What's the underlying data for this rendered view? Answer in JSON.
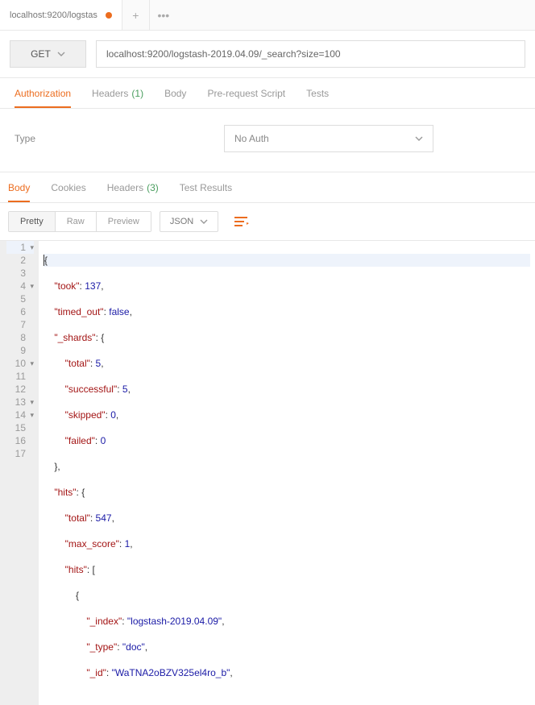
{
  "tab": {
    "title": "localhost:9200/logstas"
  },
  "request": {
    "method": "GET",
    "url": "localhost:9200/logstash-2019.04.09/_search?size=100"
  },
  "reqTabs": {
    "authorization": "Authorization",
    "headers": "Headers",
    "headersCount": "(1)",
    "body": "Body",
    "prerequest": "Pre-request Script",
    "tests": "Tests"
  },
  "auth": {
    "typeLabel": "Type",
    "typeValue": "No Auth"
  },
  "respTabs": {
    "body": "Body",
    "cookies": "Cookies",
    "headers": "Headers",
    "headersCount": "(3)",
    "testResults": "Test Results"
  },
  "viewer": {
    "pretty": "Pretty",
    "raw": "Raw",
    "preview": "Preview",
    "format": "JSON"
  },
  "code": {
    "l1": "{",
    "l2a": "\"took\"",
    "l2b": ": ",
    "l2c": "137",
    "l2d": ",",
    "l3a": "\"timed_out\"",
    "l3b": ": ",
    "l3c": "false",
    "l3d": ",",
    "l4a": "\"_shards\"",
    "l4b": ": {",
    "l5a": "\"total\"",
    "l5b": ": ",
    "l5c": "5",
    "l5d": ",",
    "l6a": "\"successful\"",
    "l6b": ": ",
    "l6c": "5",
    "l6d": ",",
    "l7a": "\"skipped\"",
    "l7b": ": ",
    "l7c": "0",
    "l7d": ",",
    "l8a": "\"failed\"",
    "l8b": ": ",
    "l8c": "0",
    "l9": "},",
    "l10a": "\"hits\"",
    "l10b": ": {",
    "l11a": "\"total\"",
    "l11b": ": ",
    "l11c": "547",
    "l11d": ",",
    "l12a": "\"max_score\"",
    "l12b": ": ",
    "l12c": "1",
    "l12d": ",",
    "l13a": "\"hits\"",
    "l13b": ": [",
    "l14": "{",
    "l15a": "\"_index\"",
    "l15b": ": ",
    "l15c": "\"logstash-2019.04.09\"",
    "l15d": ",",
    "l16a": "\"_type\"",
    "l16b": ": ",
    "l16c": "\"doc\"",
    "l16d": ",",
    "l17a": "\"_id\"",
    "l17b": ": ",
    "l17c": "\"WaTNA2oBZV325el4ro_b\"",
    "l17d": ","
  }
}
